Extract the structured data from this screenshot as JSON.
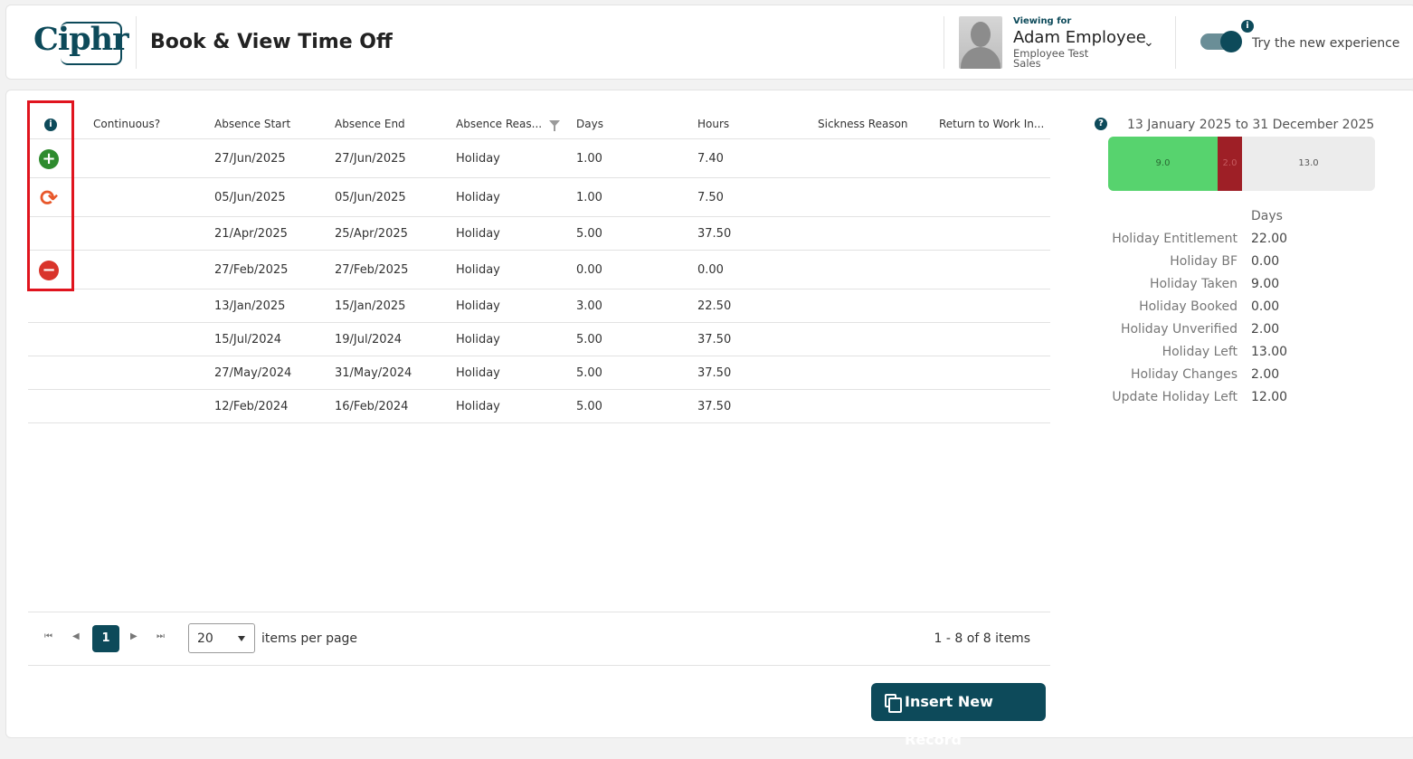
{
  "header": {
    "logo_text": "Ciphr",
    "page_title": "Book & View Time Off",
    "viewing_label": "Viewing for",
    "employee_name": "Adam Employee",
    "employee_role": "Employee Test",
    "employee_dept": "Sales",
    "toggle_label": "Try the new experience",
    "info_glyph": "i"
  },
  "colors": {
    "brand": "#0d4a5a",
    "add": "#2e8b2e",
    "refresh": "#e8572a",
    "remove": "#d9342b",
    "taken": "#57d36e",
    "unverified": "#9e1f26",
    "left": "#ececec",
    "highlight": "#e0141e"
  },
  "table": {
    "columns": [
      "Continuous?",
      "Absence Start",
      "Absence End",
      "Absence Reas...",
      "Days",
      "Hours",
      "Sickness Reason",
      "Return to Work In..."
    ],
    "header_info_glyph": "i",
    "rows": [
      {
        "continuous": "",
        "start": "27/Jun/2025",
        "end": "27/Jun/2025",
        "reason": "Holiday",
        "days": "1.00",
        "hours": "7.40",
        "sickness": "",
        "rtw": "",
        "action": "add-icon",
        "glyph": "+"
      },
      {
        "continuous": "",
        "start": "05/Jun/2025",
        "end": "05/Jun/2025",
        "reason": "Holiday",
        "days": "1.00",
        "hours": "7.50",
        "sickness": "",
        "rtw": "",
        "action": "refresh-icon",
        "glyph": "⟳"
      },
      {
        "continuous": "",
        "start": "21/Apr/2025",
        "end": "25/Apr/2025",
        "reason": "Holiday",
        "days": "5.00",
        "hours": "37.50",
        "sickness": "",
        "rtw": "",
        "action": "",
        "glyph": ""
      },
      {
        "continuous": "",
        "start": "27/Feb/2025",
        "end": "27/Feb/2025",
        "reason": "Holiday",
        "days": "0.00",
        "hours": "0.00",
        "sickness": "",
        "rtw": "",
        "action": "remove-icon",
        "glyph": "−"
      },
      {
        "continuous": "",
        "start": "13/Jan/2025",
        "end": "15/Jan/2025",
        "reason": "Holiday",
        "days": "3.00",
        "hours": "22.50",
        "sickness": "",
        "rtw": "",
        "action": "",
        "glyph": ""
      },
      {
        "continuous": "",
        "start": "15/Jul/2024",
        "end": "19/Jul/2024",
        "reason": "Holiday",
        "days": "5.00",
        "hours": "37.50",
        "sickness": "",
        "rtw": "",
        "action": "",
        "glyph": ""
      },
      {
        "continuous": "",
        "start": "27/May/2024",
        "end": "31/May/2024",
        "reason": "Holiday",
        "days": "5.00",
        "hours": "37.50",
        "sickness": "",
        "rtw": "",
        "action": "",
        "glyph": ""
      },
      {
        "continuous": "",
        "start": "12/Feb/2024",
        "end": "16/Feb/2024",
        "reason": "Holiday",
        "days": "5.00",
        "hours": "37.50",
        "sickness": "",
        "rtw": "",
        "action": "",
        "glyph": ""
      }
    ]
  },
  "pager": {
    "first": "⏮",
    "prev": "◀",
    "current": "1",
    "next": "▶",
    "last": "⏭",
    "page_size": "20",
    "items_per_page_label": "items per page",
    "count_label": "1 - 8 of 8 items"
  },
  "insert_button": "Insert New Record",
  "summary": {
    "help_glyph": "?",
    "range": "13 January 2025 to 31 December 2025",
    "bar": [
      {
        "label": "9.0",
        "value": 9.0,
        "color": "#57d36e",
        "text_color": "#2a6a33"
      },
      {
        "label": "2.0",
        "value": 2.0,
        "color": "#9e1f26",
        "text_color": "#c65a5f"
      },
      {
        "label": "13.0",
        "value": 13.0,
        "color": "#ececec",
        "text_color": "#555555"
      }
    ],
    "col_head": "Days",
    "rows": [
      {
        "label": "Holiday Entitlement",
        "value": "22.00"
      },
      {
        "label": "Holiday BF",
        "value": "0.00"
      },
      {
        "label": "Holiday Taken",
        "value": "9.00"
      },
      {
        "label": "Holiday Booked",
        "value": "0.00"
      },
      {
        "label": "Holiday Unverified",
        "value": "2.00"
      },
      {
        "label": "Holiday Left",
        "value": "13.00"
      },
      {
        "label": "Holiday Changes",
        "value": "2.00"
      },
      {
        "label": "Update Holiday Left",
        "value": "12.00"
      }
    ]
  }
}
